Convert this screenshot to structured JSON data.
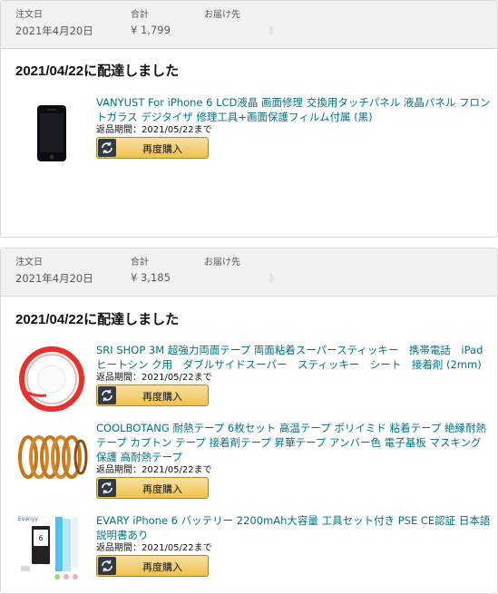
{
  "orders": [
    {
      "date_label": "注文日",
      "date": "2021年4月20日",
      "total_label": "合計",
      "total": "¥ 1,799",
      "ship_label": "お届け先",
      "delivery_status": "2021/04/22に配達しました",
      "items": [
        {
          "title": "VANYUST For iPhone 6 LCD液晶 画面修理 交換用タッチパネル 液晶パネル フロントガラス デジタイザ 修理工具+画面保護フィルム付属 (黒)",
          "return": "返品期間：2021/05/22まで",
          "button": "再度購入"
        }
      ]
    },
    {
      "date_label": "注文日",
      "date": "2021年4月20日",
      "total_label": "合計",
      "total": "¥ 3,185",
      "ship_label": "お届け先",
      "delivery_status": "2021/04/22に配達しました",
      "items": [
        {
          "title": "SRI SHOP 3M 超強力両面テープ 両面粘着スーパースティッキー　携帯電話　iPad ヒートシン ク用　ダブルサイドスーパー　スティッキー　シート　接着剤 (2mm)",
          "return": "返品期間：2021/05/22まで",
          "button": "再度購入"
        },
        {
          "title": "COOLBOTANG 耐熱テープ 6枚セット 高温テープ ポリイミド 粘着テープ 絶縁耐熱テープ カプトン テープ 接着剤テープ 昇華テープ アンバー色 電子基板 マスキング 保護 高耐熱テープ",
          "return": "返品期間：2021/05/22まで",
          "button": "再度購入"
        },
        {
          "title": "EVARY iPhone 6 バッテリー 2200mAh大容量 工具セット付き PSE CE認証 日本語説明書あり",
          "return": "返品期間：2021/05/22まで",
          "button": "再度購入",
          "image_text": "Evanyy"
        }
      ]
    }
  ]
}
